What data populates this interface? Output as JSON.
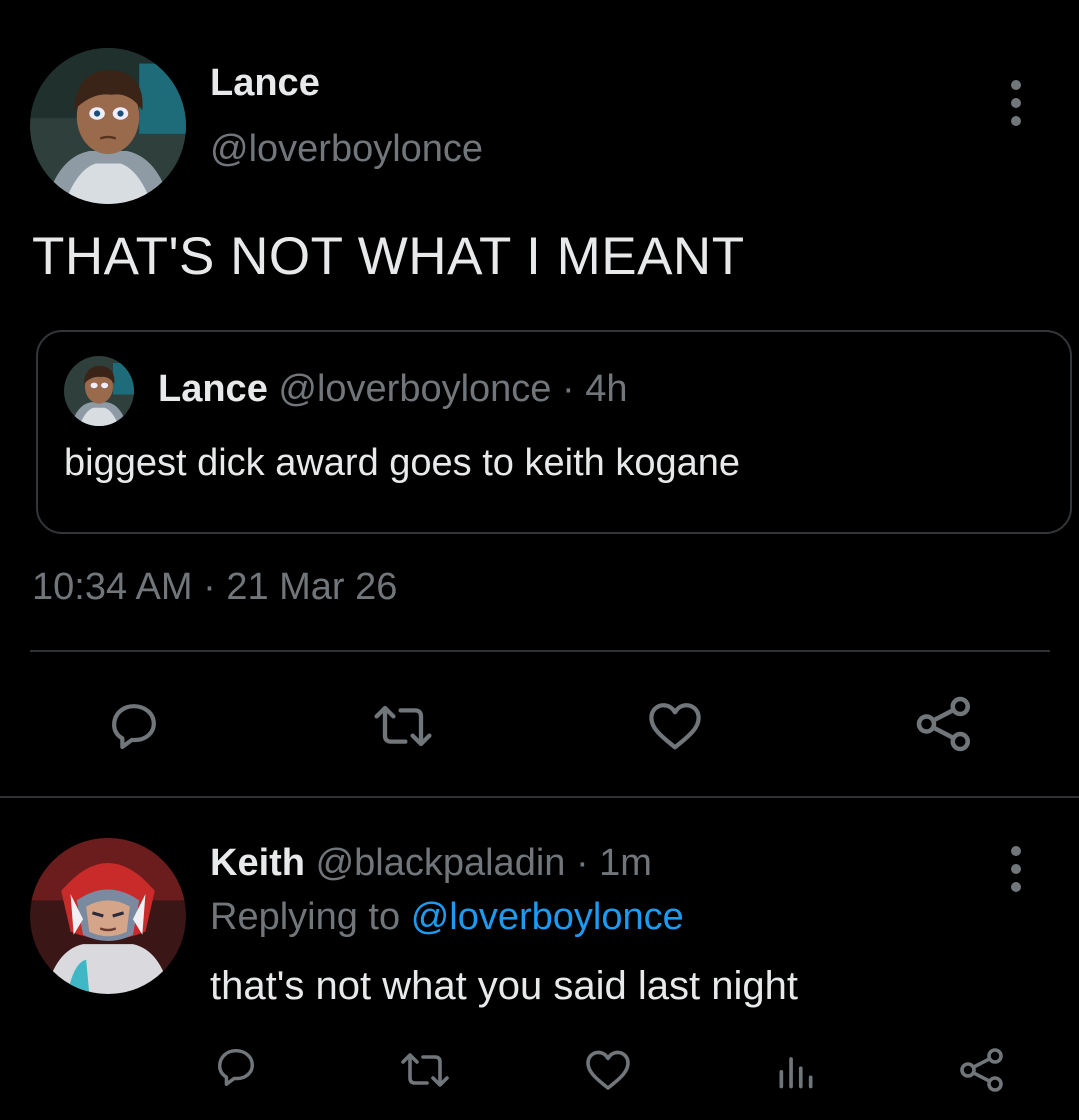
{
  "tweet": {
    "author_name": "Lance",
    "author_handle": "@loverboylonce",
    "text": "THAT'S NOT WHAT I MEANT",
    "timestamp": "10:34 AM · 21 Mar 26",
    "quoted": {
      "author_name": "Lance",
      "meta": "@loverboylonce · 4h",
      "text": "biggest dick award goes to keith kogane"
    },
    "actions": [
      "reply-icon",
      "retweet-icon",
      "like-icon",
      "share-icon"
    ]
  },
  "reply": {
    "author_name": "Keith",
    "meta": "@blackpaladin · 1m",
    "replying_prefix": "Replying to",
    "replying_handle": "@loverboylonce",
    "text": "that's not what you said last night",
    "actions": [
      "reply-icon",
      "retweet-icon",
      "like-icon",
      "analytics-icon",
      "share-icon"
    ]
  },
  "colors": {
    "background": "#000000",
    "text_primary": "#e7e9ea",
    "text_secondary": "#71767b",
    "link": "#1d9bf0",
    "border": "#333639"
  }
}
